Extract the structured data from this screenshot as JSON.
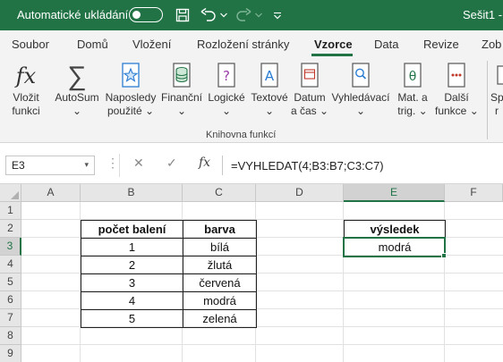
{
  "titlebar": {
    "autosave_label": "Automatické ukládání",
    "doc_title": "Sešit1 -"
  },
  "tabs": [
    "Soubor",
    "Domů",
    "Vložení",
    "Rozložení stránky",
    "Vzorce",
    "Data",
    "Revize",
    "Zob"
  ],
  "active_tab": "Vzorce",
  "ribbon": {
    "buttons": [
      {
        "line1": "Vložit",
        "line2": "funkci",
        "icon": "fx-icon"
      },
      {
        "line1": "AutoSum",
        "line2": "⌄",
        "icon": "sigma-icon"
      },
      {
        "line1": "Naposledy",
        "line2": "použité ⌄",
        "icon": "star-icon"
      },
      {
        "line1": "Finanční",
        "line2": "⌄",
        "icon": "database-icon"
      },
      {
        "line1": "Logické",
        "line2": "⌄",
        "icon": "question-book-icon"
      },
      {
        "line1": "Textové",
        "line2": "⌄",
        "icon": "text-book-icon"
      },
      {
        "line1": "Datum",
        "line2": "a čas ⌄",
        "icon": "calendar-book-icon"
      },
      {
        "line1": "Vyhledávací",
        "line2": "⌄",
        "icon": "search-book-icon"
      },
      {
        "line1": "Mat. a",
        "line2": "trig. ⌄",
        "icon": "theta-book-icon"
      },
      {
        "line1": "Další",
        "line2": "funkce ⌄",
        "icon": "more-functions-icon"
      },
      {
        "line1": "Sp",
        "line2": "r",
        "icon": "name-manager-icon"
      }
    ],
    "group_label": "Knihovna funkcí"
  },
  "formula_bar": {
    "name_box": "E3",
    "fx_label": "fx",
    "formula": "=VYHLEDAT(4;B3:B7;C3:C7)"
  },
  "grid": {
    "columns": [
      "A",
      "B",
      "C",
      "D",
      "E",
      "F"
    ],
    "rows": [
      "1",
      "2",
      "3",
      "4",
      "5",
      "6",
      "7",
      "8",
      "9"
    ],
    "selected_cell": "E3",
    "table_headers": {
      "count": "počet balení",
      "color": "barva"
    },
    "table_rows": [
      {
        "count": "1",
        "color": "bílá"
      },
      {
        "count": "2",
        "color": "žlutá"
      },
      {
        "count": "3",
        "color": "červená"
      },
      {
        "count": "4",
        "color": "modrá"
      },
      {
        "count": "5",
        "color": "zelená"
      }
    ],
    "result_header": "výsledek",
    "result_value": "modrá"
  },
  "colors": {
    "accent": "#217346"
  }
}
